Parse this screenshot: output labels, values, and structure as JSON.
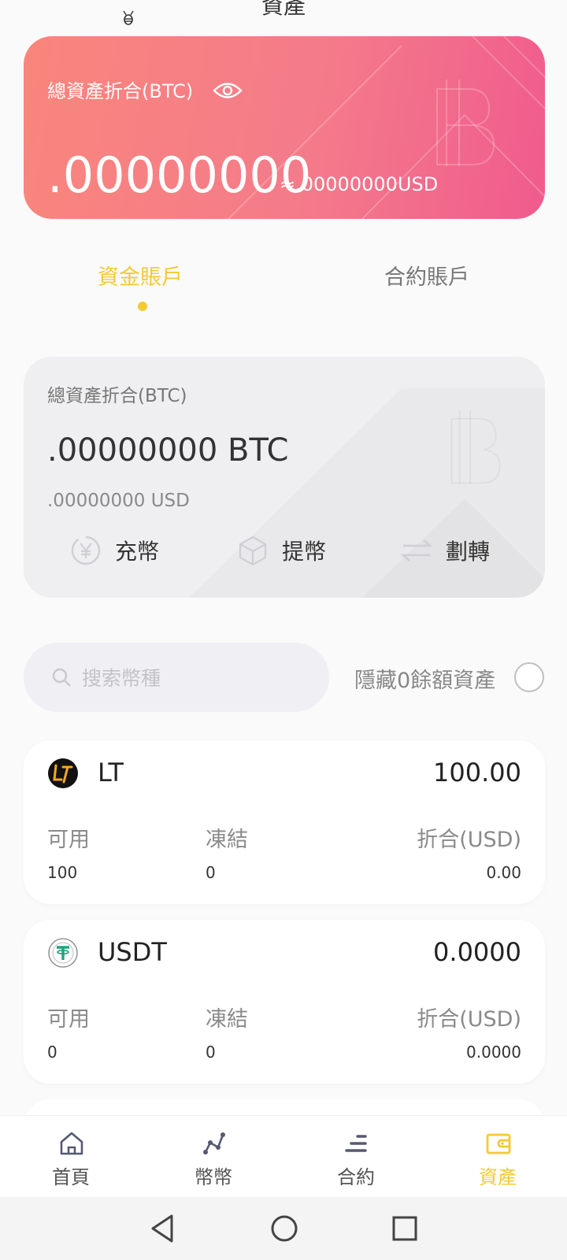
{
  "header": {
    "title": "資產"
  },
  "hero": {
    "label": "總資產折合(BTC)",
    "amount": ".00000000",
    "approx": "≈.00000000USD",
    "gradient_start": "#f9867c",
    "gradient_end": "#f05b8d"
  },
  "tabs": [
    {
      "label": "資金賬戶",
      "active": true
    },
    {
      "label": "合約賬戶",
      "active": false
    }
  ],
  "account": {
    "label": "總資產折合(BTC)",
    "amount": ".00000000 BTC",
    "usd": ".00000000 USD",
    "actions": [
      {
        "label": "充幣",
        "icon": "yen-icon"
      },
      {
        "label": "提幣",
        "icon": "cube-icon"
      },
      {
        "label": "劃轉",
        "icon": "transfer-arrows-icon"
      }
    ]
  },
  "search": {
    "placeholder": "搜索幣種",
    "hide_zero_label": "隱藏0餘額資產"
  },
  "coins": [
    {
      "symbol": "LT",
      "balance": "100.00",
      "headers": [
        "可用",
        "凍結",
        "折合(USD)"
      ],
      "values": [
        "100",
        "0",
        "0.00"
      ],
      "icon": "lt-coin-icon"
    },
    {
      "symbol": "USDT",
      "balance": "0.0000",
      "headers": [
        "可用",
        "凍結",
        "折合(USD)"
      ],
      "values": [
        "0",
        "0",
        "0.0000"
      ],
      "icon": "tether-icon"
    }
  ],
  "bottom_nav": [
    {
      "label": "首頁",
      "icon": "home-icon",
      "active": false
    },
    {
      "label": "幣幣",
      "icon": "trade-graph-icon",
      "active": false
    },
    {
      "label": "合約",
      "icon": "contract-bars-icon",
      "active": false
    },
    {
      "label": "資產",
      "icon": "wallet-icon",
      "active": true
    }
  ],
  "colors": {
    "accent": "#f5c935",
    "text": "#222222",
    "muted": "#8a8a8a"
  }
}
